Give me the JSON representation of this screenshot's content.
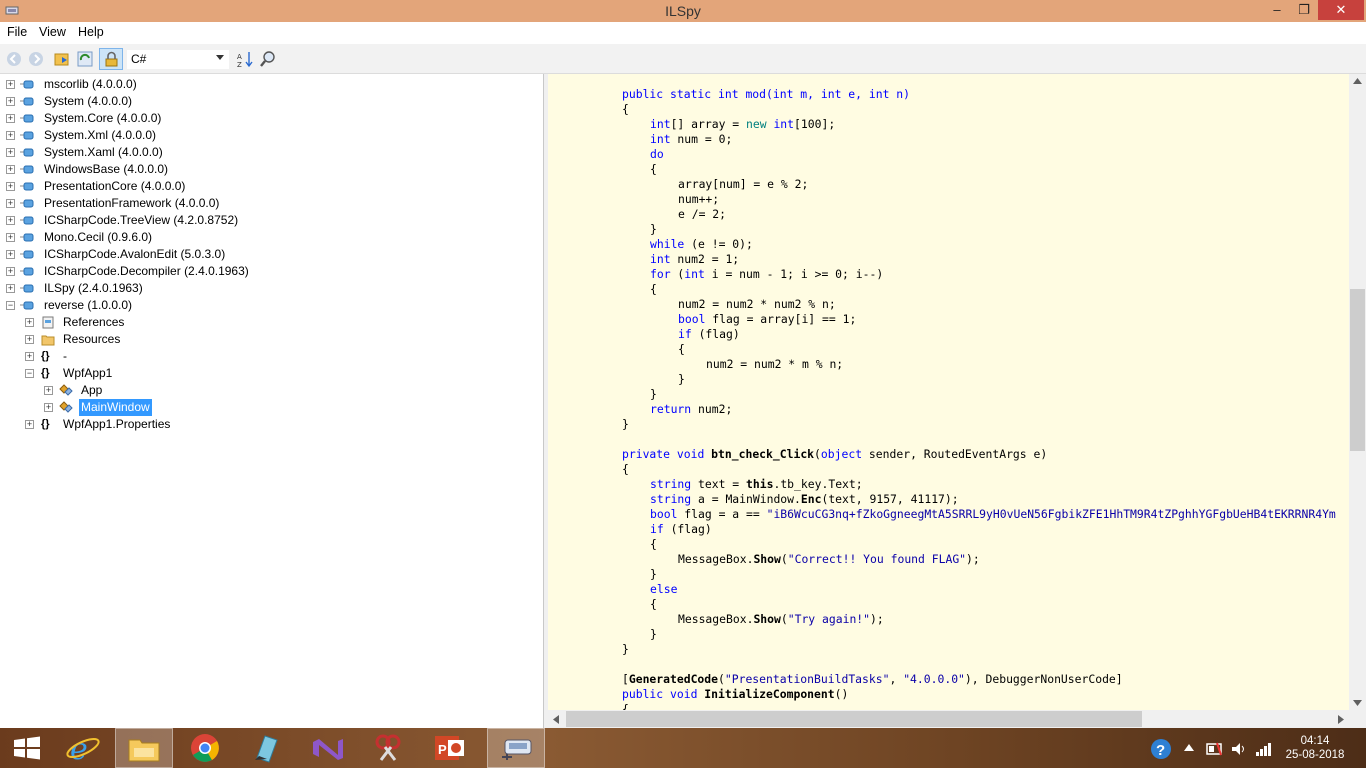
{
  "window": {
    "title": "ILSpy",
    "minimize": "‒",
    "restore": "❐",
    "close": "✕"
  },
  "menu": {
    "file": "File",
    "view": "View",
    "help": "Help"
  },
  "toolbar": {
    "language": "C#"
  },
  "tree": [
    {
      "label": "mscorlib (4.0.0.0)"
    },
    {
      "label": "System (4.0.0.0)"
    },
    {
      "label": "System.Core (4.0.0.0)"
    },
    {
      "label": "System.Xml (4.0.0.0)"
    },
    {
      "label": "System.Xaml (4.0.0.0)"
    },
    {
      "label": "WindowsBase (4.0.0.0)"
    },
    {
      "label": "PresentationCore (4.0.0.0)"
    },
    {
      "label": "PresentationFramework (4.0.0.0)"
    },
    {
      "label": "ICSharpCode.TreeView (4.2.0.8752)"
    },
    {
      "label": "Mono.Cecil (0.9.6.0)"
    },
    {
      "label": "ICSharpCode.AvalonEdit (5.0.3.0)"
    },
    {
      "label": "ICSharpCode.Decompiler (2.4.0.1963)"
    },
    {
      "label": "ILSpy (2.4.0.1963)"
    },
    {
      "label": "reverse (1.0.0.0)"
    },
    {
      "label": "References"
    },
    {
      "label": "Resources"
    },
    {
      "label": "-"
    },
    {
      "label": "WpfApp1"
    },
    {
      "label": "App"
    },
    {
      "label": "MainWindow"
    },
    {
      "label": "WpfApp1.Properties"
    }
  ],
  "code": {
    "l1_a": "public static int mod(int m, int e, int n)",
    "l2": "{",
    "l3_t": "int",
    "l3_b": "[] array = ",
    "l3_new": "new",
    "l3_c": " int",
    "l3_d": "[100];",
    "l4_t": "int",
    "l4_b": " num = 0;",
    "l5": "do",
    "l6": "{",
    "l7": "array[num] = e % 2;",
    "l8": "num++;",
    "l9": "e /= 2;",
    "l10": "}",
    "l11_k": "while",
    "l11_b": " (e != 0);",
    "l12_t": "int",
    "l12_b": " num2 = 1;",
    "l13_k": "for",
    "l13_b": " (",
    "l13_t": "int",
    "l13_c": " i = num - 1; i >= 0; i--)",
    "l14": "{",
    "l15": "num2 = num2 * num2 % n;",
    "l16_t": "bool",
    "l16_b": " flag = array[i] == 1;",
    "l17_k": "if",
    "l17_b": " (flag)",
    "l18": "{",
    "l19": "num2 = num2 * m % n;",
    "l20": "}",
    "l21": "}",
    "l22_k": "return",
    "l22_b": " num2;",
    "l23": "}",
    "l25_a": "private",
    "l25_b": " void",
    "l25_c": " btn_check_Click",
    "l25_d": "(",
    "l25_e": "object",
    "l25_f": " sender, RoutedEventArgs e)",
    "l26": "{",
    "l27_t": "string",
    "l27_b": " text = ",
    "l27_this": "this",
    "l27_c": ".tb_key.Text;",
    "l28_t": "string",
    "l28_b": " a = MainWindow.",
    "l28_m": "Enc",
    "l28_c": "(text, 9157, 41117);",
    "l29_t": "bool",
    "l29_b": " flag = a == ",
    "l29_s": "\"iB6WcuCG3nq+fZkoGgneegMtA5SRRL9yH0vUeN56FgbikZFE1HhTM9R4tZPghhYGFgbUeHB4tEKRRNR4Ym",
    "l30_k": "if",
    "l30_b": " (flag)",
    "l31": "{",
    "l32_a": "MessageBox.",
    "l32_m": "Show",
    "l32_b": "(",
    "l32_s": "\"Correct!! You found FLAG\"",
    "l32_c": ");",
    "l33": "}",
    "l34": "else",
    "l35": "{",
    "l36_a": "MessageBox.",
    "l36_m": "Show",
    "l36_b": "(",
    "l36_s": "\"Try again!\"",
    "l36_c": ");",
    "l37": "}",
    "l38": "}",
    "l40_a": "[",
    "l40_g": "GeneratedCode",
    "l40_b": "(",
    "l40_s1": "\"PresentationBuildTasks\"",
    "l40_c": ", ",
    "l40_s2": "\"4.0.0.0\"",
    "l40_d": "), DebuggerNonUserCode]",
    "l41_a": "public",
    "l41_b": " void",
    "l41_c": " InitializeComponent",
    "l41_d": "()",
    "l42": "{"
  },
  "clock": {
    "time": "04:14",
    "date": "25-08-2018"
  }
}
